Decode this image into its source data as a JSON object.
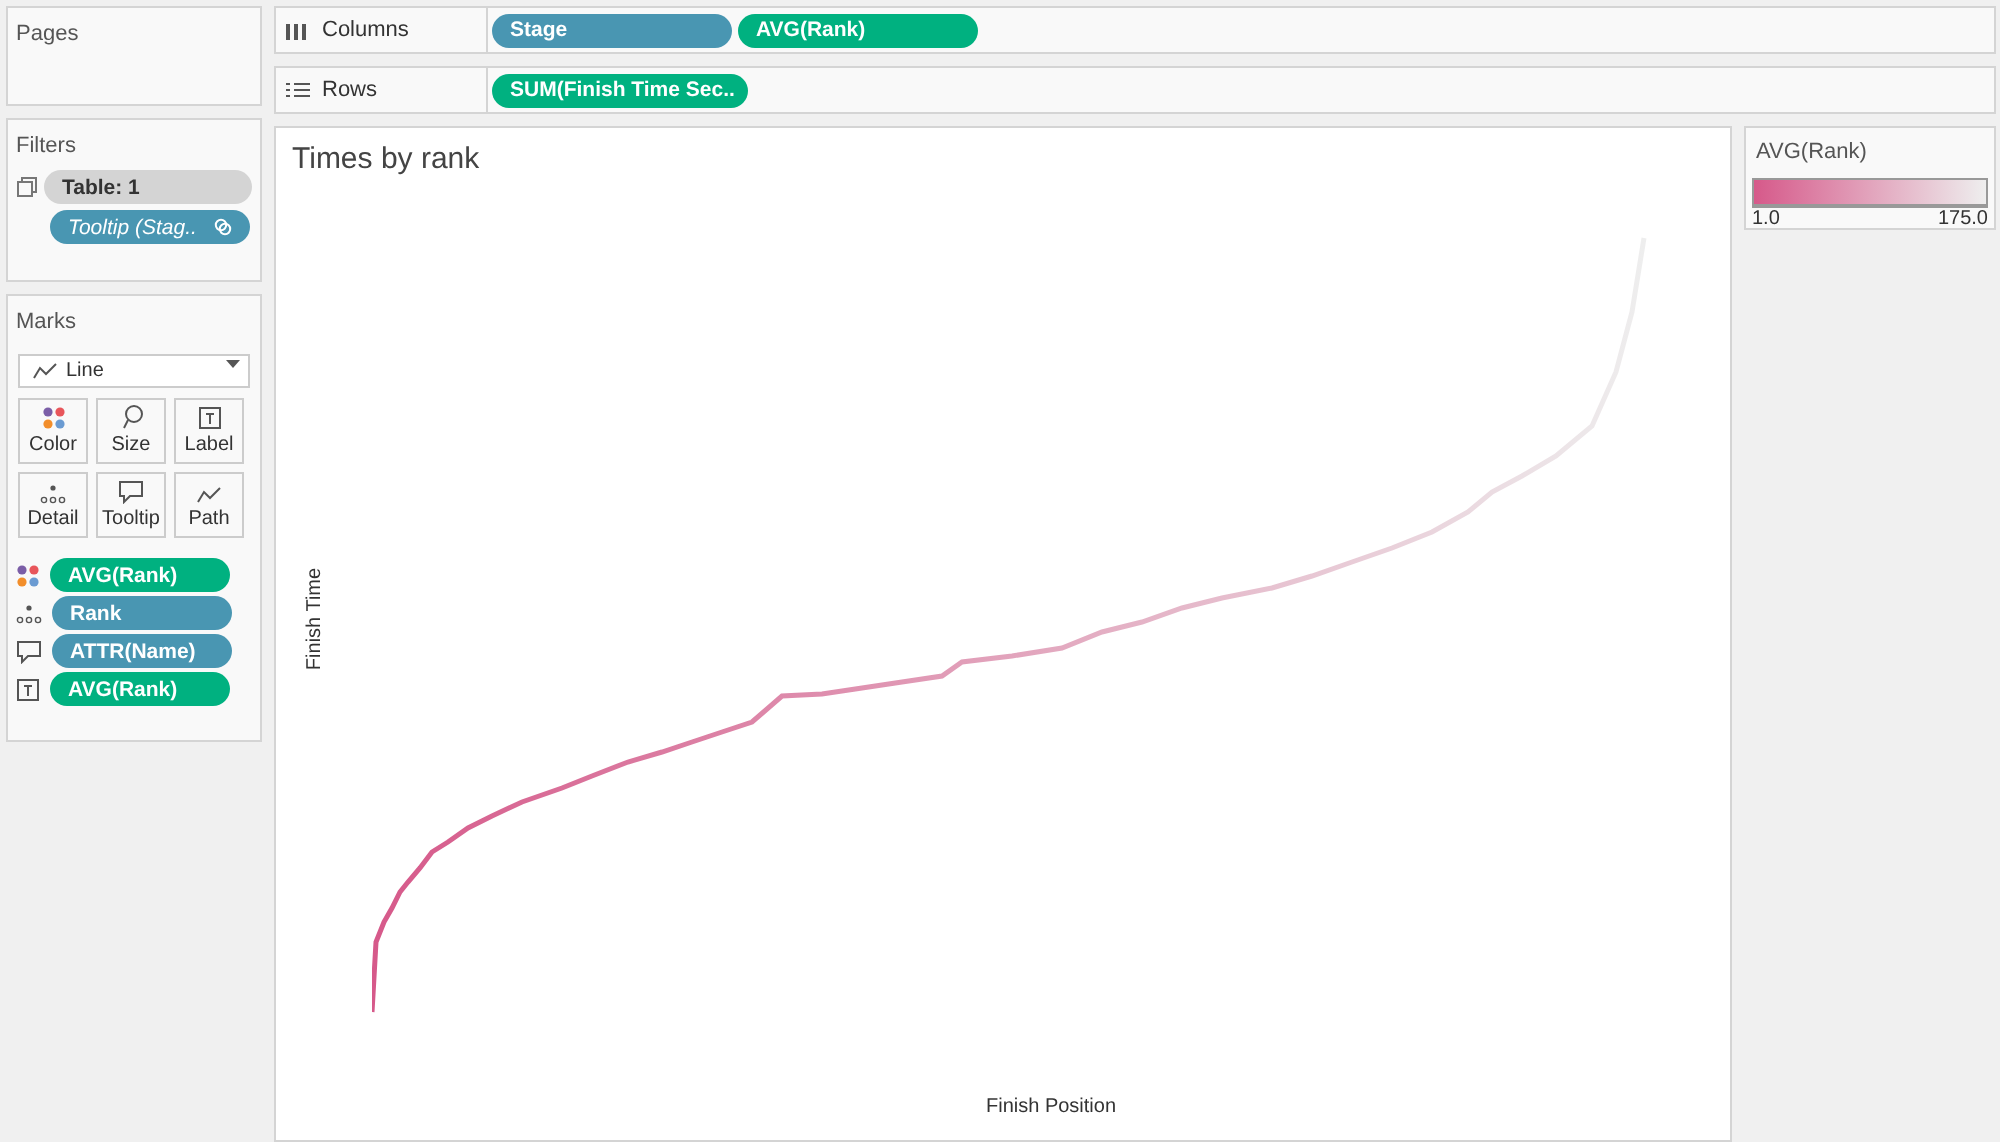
{
  "pages": {
    "title": "Pages"
  },
  "columns": {
    "label": "Columns",
    "pills": [
      {
        "text": "Stage",
        "kind": "dimension"
      },
      {
        "text": "AVG(Rank)",
        "kind": "measure"
      }
    ]
  },
  "rows": {
    "label": "Rows",
    "pills": [
      {
        "text": "SUM(Finish Time Sec..",
        "kind": "measure"
      }
    ]
  },
  "filters": {
    "title": "Filters",
    "pills": [
      {
        "text": "Table: 1",
        "kind": "plain"
      },
      {
        "text": "Tooltip (Stag..",
        "kind": "calc"
      }
    ]
  },
  "marks": {
    "title": "Marks",
    "mark_type": "Line",
    "buttons": [
      {
        "label": "Color",
        "kind": "color"
      },
      {
        "label": "Size",
        "kind": "size"
      },
      {
        "label": "Label",
        "kind": "label"
      },
      {
        "label": "Detail",
        "kind": "detail"
      },
      {
        "label": "Tooltip",
        "kind": "tooltip"
      },
      {
        "label": "Path",
        "kind": "path"
      }
    ],
    "pills": [
      {
        "text": "AVG(Rank)",
        "kind": "color",
        "color": "#00b180"
      },
      {
        "text": "Rank",
        "kind": "detail",
        "color": "#4996b2"
      },
      {
        "text": "ATTR(Name)",
        "kind": "tooltip",
        "color": "#4996b2"
      },
      {
        "text": "AVG(Rank)",
        "kind": "label",
        "color": "#00b180"
      }
    ]
  },
  "view": {
    "title": "Times by rank",
    "xlabel": "Finish Position",
    "ylabel": "Finish Time"
  },
  "legend": {
    "title": "AVG(Rank)",
    "min": "1.0",
    "max": "175.0"
  }
}
